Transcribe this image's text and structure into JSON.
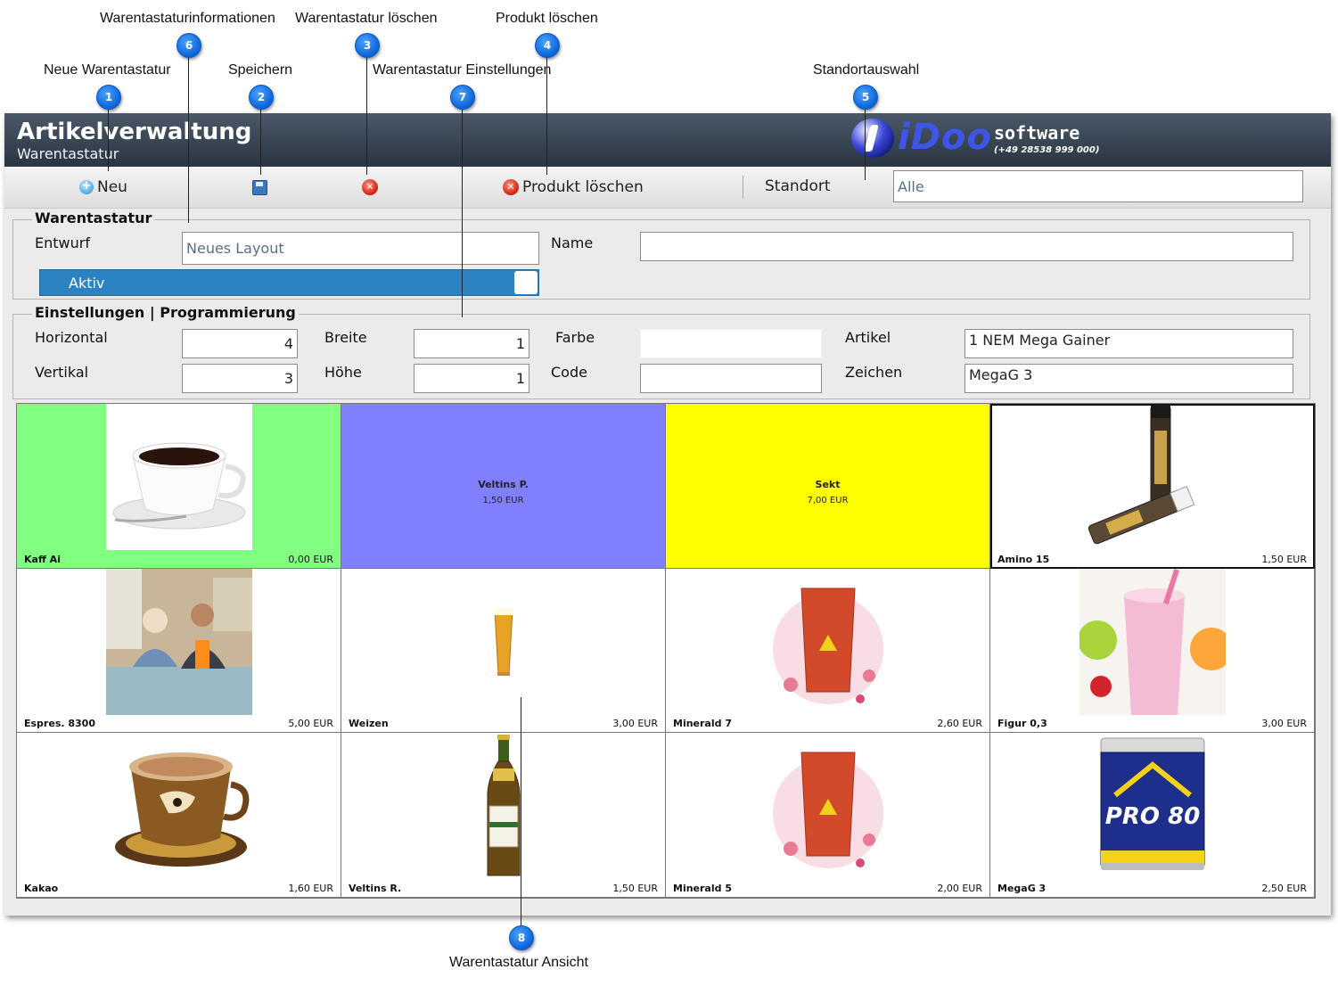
{
  "callouts": [
    {
      "num": "1",
      "label": "Neue Warentastatur"
    },
    {
      "num": "2",
      "label": "Speichern"
    },
    {
      "num": "3",
      "label": "Warentastatur löschen"
    },
    {
      "num": "4",
      "label": "Produkt löschen"
    },
    {
      "num": "5",
      "label": "Standortauswahl"
    },
    {
      "num": "6",
      "label": "Warentastaturinformationen"
    },
    {
      "num": "7",
      "label": "Warentastatur Einstellungen"
    },
    {
      "num": "8",
      "label": "Warentastatur Ansicht"
    }
  ],
  "header": {
    "title": "Artikelverwaltung",
    "subtitle": "Warentastatur",
    "logo_brand": "iDoo",
    "logo_software": "software",
    "logo_phone": "(+49 28538 999 000)"
  },
  "toolbar": {
    "new_label": "Neu",
    "delete_product_label": "Produkt löschen",
    "location_label": "Standort",
    "location_value": "Alle"
  },
  "keyboard_info": {
    "group_title": "Warentastatur",
    "draft_label": "Entwurf",
    "draft_value": "Neues Layout",
    "name_label": "Name",
    "name_value": "",
    "active_label": "Aktiv",
    "active": true
  },
  "settings": {
    "group_title": "Einstellungen | Programmierung",
    "horizontal_label": "Horizontal",
    "horizontal_value": "4",
    "vertical_label": "Vertikal",
    "vertical_value": "3",
    "width_label": "Breite",
    "width_value": "1",
    "height_label": "Höhe",
    "height_value": "1",
    "color_label": "Farbe",
    "color_value": "",
    "code_label": "Code",
    "code_value": "",
    "article_label": "Artikel",
    "article_value": "1 NEM Mega Gainer",
    "chars_label": "Zeichen",
    "chars_value": "MegaG 3"
  },
  "tiles": [
    {
      "name": "Kaff Ai",
      "price": "0,00 EUR",
      "bg": "#80ff80",
      "image": "coffee-cup"
    },
    {
      "name": "Veltins P.",
      "price": "1,50 EUR",
      "bg": "#8080ff",
      "image": ""
    },
    {
      "name": "Sekt",
      "price": "7,00 EUR",
      "bg": "#ffff00",
      "image": ""
    },
    {
      "name": "Amino 15",
      "price": "1,50 EUR",
      "bg": "#ffffff",
      "image": "amino-ampoules"
    },
    {
      "name": "Espres. 8300",
      "price": "5,00 EUR",
      "bg": "#ffffff",
      "image": "people-photo"
    },
    {
      "name": "Weizen",
      "price": "3,00 EUR",
      "bg": "#ffffff",
      "image": "wheat-beer-glass"
    },
    {
      "name": "Minerald 7",
      "price": "2,60 EUR",
      "bg": "#ffffff",
      "image": "red-drink-glass"
    },
    {
      "name": "Figur 0,3",
      "price": "3,00 EUR",
      "bg": "#ffffff",
      "image": "milkshake"
    },
    {
      "name": "Kakao",
      "price": "1,60 EUR",
      "bg": "#ffffff",
      "image": "cappuccino-cup"
    },
    {
      "name": "Veltins R.",
      "price": "1,50 EUR",
      "bg": "#ffffff",
      "image": "beer-bottle"
    },
    {
      "name": "Minerald 5",
      "price": "2,00 EUR",
      "bg": "#ffffff",
      "image": "red-drink-glass"
    },
    {
      "name": "MegaG 3",
      "price": "2,50 EUR",
      "bg": "#ffffff",
      "image": "protein-can"
    }
  ],
  "protein_can_text": "PRO 80",
  "colors": {
    "accent": "#2d83c2",
    "header_dark": "#2a3542",
    "callout_blue": "#0b63d8"
  }
}
